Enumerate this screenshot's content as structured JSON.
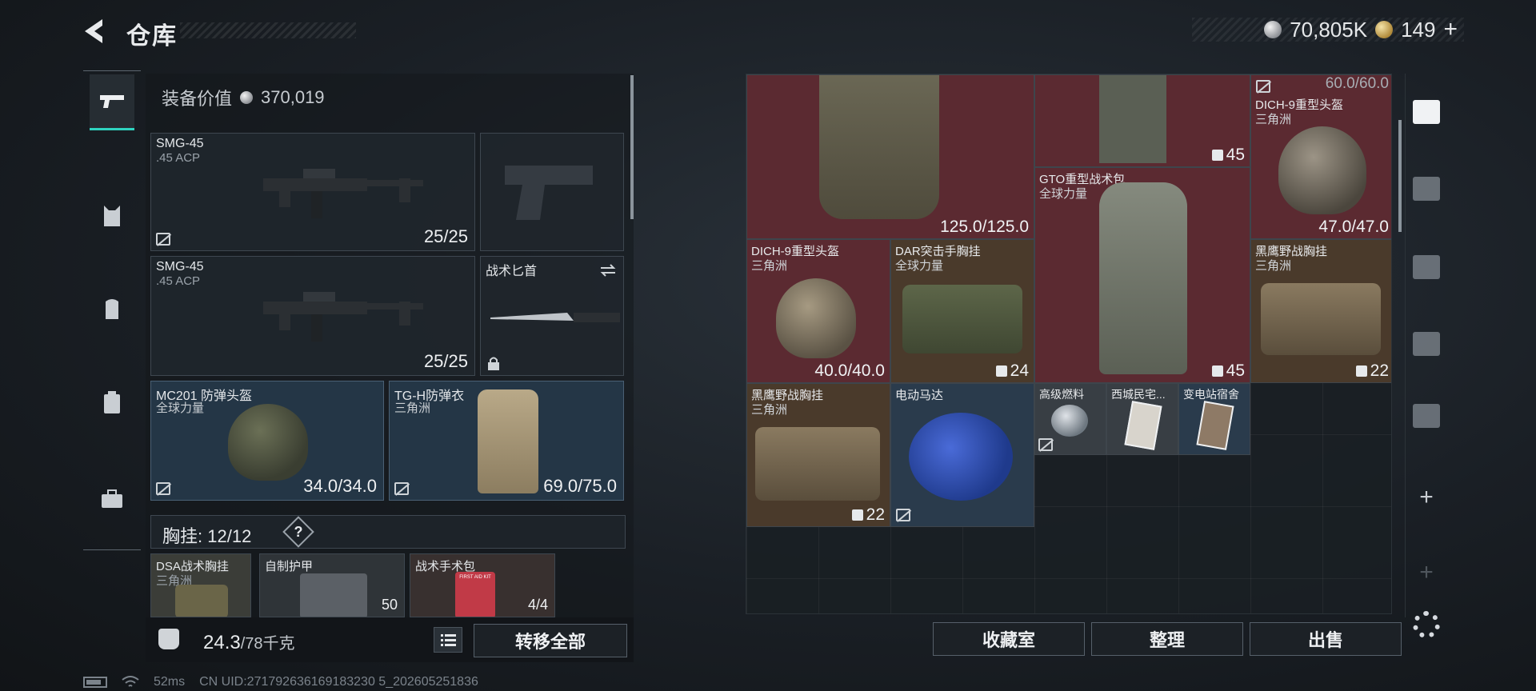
{
  "header": {
    "title": "仓库",
    "currency_silver": "70,805K",
    "currency_gold": "149",
    "add_label": "+"
  },
  "left_nav": {
    "items": [
      {
        "icon": "pistol-icon",
        "active": true
      },
      {
        "icon": "rig-icon",
        "active": false
      },
      {
        "icon": "backpack-icon",
        "active": false
      },
      {
        "icon": "locker-icon",
        "active": false
      },
      {
        "icon": "briefcase-icon",
        "active": false
      }
    ]
  },
  "equipment": {
    "value_label": "装备价值",
    "value": "370,019",
    "weapon1": {
      "name": "SMG-45",
      "ammo": ".45 ACP",
      "count": "25/25"
    },
    "weapon2": {
      "name": "SMG-45",
      "ammo": ".45 ACP",
      "count": "25/25"
    },
    "knife": {
      "name": "战术匕首"
    },
    "helmet": {
      "name": "MC201 防弹头盔",
      "faction": "全球力量",
      "durability": "34.0/34.0"
    },
    "armor": {
      "name": "TG-H防弹衣",
      "faction": "三角洲",
      "durability": "69.0/75.0"
    },
    "rig": {
      "label": "胸挂:",
      "capacity": "12/12",
      "help": "?"
    },
    "rig_items": [
      {
        "name": "DSA战术胸挂",
        "faction": "三角洲"
      },
      {
        "name": "自制护甲",
        "value": "50"
      },
      {
        "name": "战术手术包",
        "value": "4/4",
        "kit_text": "FIRST AID KIT"
      }
    ]
  },
  "bottom_bar": {
    "weight_current": "24.3",
    "weight_max": "/78千克",
    "transfer_label": "转移全部"
  },
  "stash": {
    "cells": [
      {
        "id": "vest-top",
        "value": "125.0/125.0"
      },
      {
        "id": "pack-top",
        "value": "45"
      },
      {
        "id": "helmet-dich-1",
        "value_top": "60.0/60.0",
        "name": "DICH-9重型头盔",
        "faction": "三角洲",
        "value": "47.0/47.0"
      },
      {
        "id": "gto-bag",
        "name": "GTO重型战术包",
        "faction": "全球力量",
        "value": "45"
      },
      {
        "id": "helmet-dich-2",
        "name": "DICH-9重型头盔",
        "faction": "三角洲",
        "value": "40.0/40.0"
      },
      {
        "id": "dar-rig",
        "name": "DAR突击手胸挂",
        "faction": "全球力量",
        "value": "24"
      },
      {
        "id": "blackhawk-rig-1",
        "name": "黑鹰野战胸挂",
        "faction": "三角洲",
        "value": "22"
      },
      {
        "id": "blackhawk-rig-2",
        "name": "黑鹰野战胸挂",
        "faction": "三角洲",
        "value": "22"
      },
      {
        "id": "motor",
        "name": "电动马达"
      },
      {
        "id": "fuel",
        "name": "高级燃料"
      },
      {
        "id": "west-card",
        "name": "西城民宅..."
      },
      {
        "id": "substation-card",
        "name": "变电站宿舍"
      }
    ]
  },
  "actions": {
    "collection": "收藏室",
    "sort": "整理",
    "sell": "出售"
  },
  "status": {
    "ping": "52ms",
    "uid": "CN UID:271792636169183230 5_202605251836"
  },
  "colors": {
    "accent": "#2fd3c0",
    "cell_red": "#5b2a31",
    "cell_brown": "#4a3a2b",
    "cell_blue": "#2a3b4c"
  }
}
